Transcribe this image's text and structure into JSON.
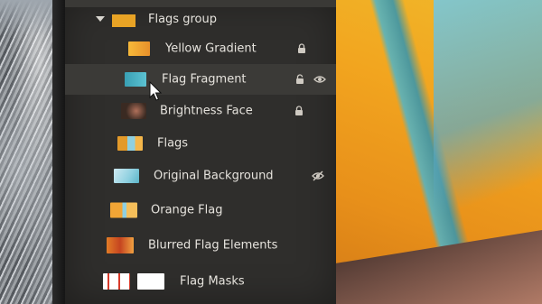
{
  "layers": {
    "group": {
      "label": "Flags group",
      "thumb_color": "#e8a325"
    },
    "items": [
      {
        "label": "Yellow Gradient",
        "thumb_color": "#f0a42a",
        "right_icons": [
          "lock-icon"
        ]
      },
      {
        "label": "Flag Fragment",
        "thumb_color": "#4aa7b8",
        "right_icons": [
          "unlock-icon",
          "eye-icon"
        ]
      },
      {
        "label": "Brightness Face",
        "thumb_color": "#3a2a22",
        "right_icons": [
          "lock-icon"
        ]
      },
      {
        "label": "Flags",
        "thumb_color": "#e39a2a",
        "right_icons": []
      },
      {
        "label": "Original Background",
        "thumb_color": "#8fd0e0",
        "right_icons": [
          "eye-off-icon"
        ]
      },
      {
        "label": "Orange Flag",
        "thumb_color": "#f2a535",
        "right_icons": []
      },
      {
        "label": "Blurred Flag Elements",
        "thumb_color": "#e27c26",
        "right_icons": []
      },
      {
        "label": "Flag Masks",
        "thumb_color": "#ffffff",
        "right_icons": []
      }
    ]
  },
  "colors": {
    "panel_bg": "#2f2e2c",
    "text": "#e6e3dd",
    "icon": "#cfcac2",
    "accent_yellow": "#f0b92b"
  }
}
